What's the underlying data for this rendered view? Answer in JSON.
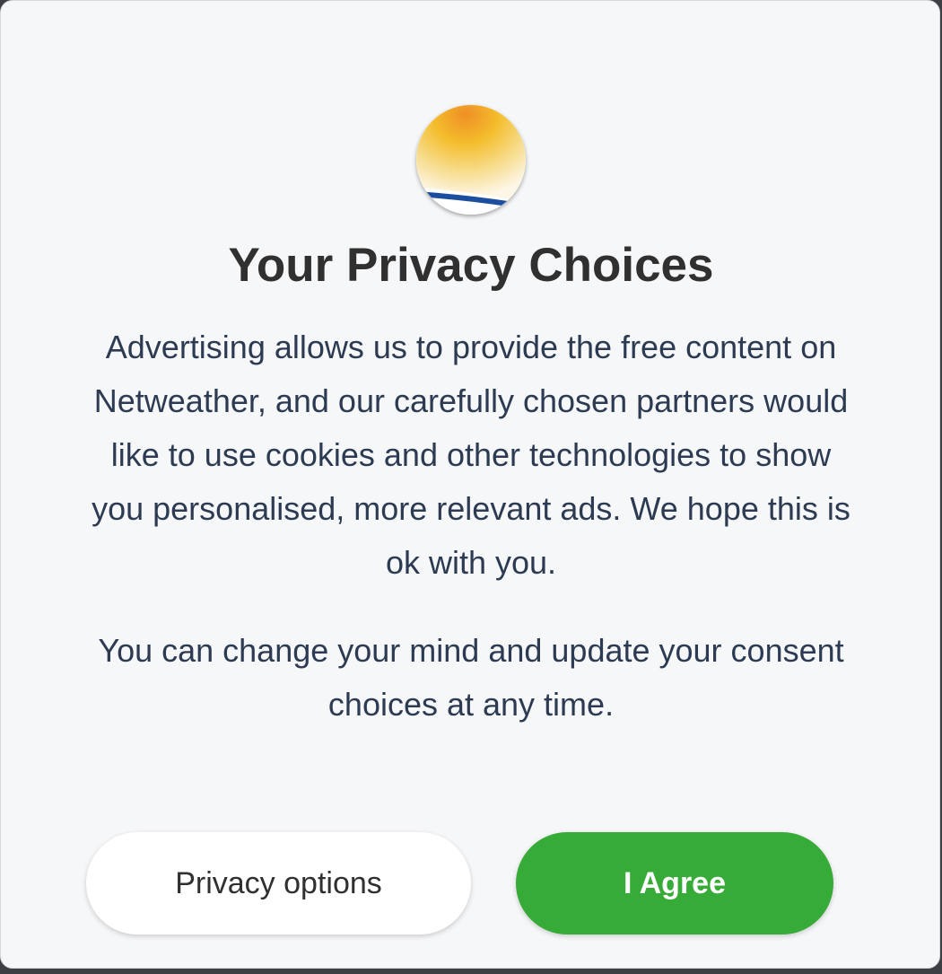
{
  "dialog": {
    "logo": {
      "icon": "netweather-sun-logo-icon"
    },
    "title": "Your Privacy Choices",
    "paragraphs": [
      "Advertising allows us to provide the free content on Netweather, and our carefully chosen partners would like to use cookies and other technologies to show you personalised, more relevant ads. We hope this is ok with you.",
      "You can change your mind and update your consent choices at any time."
    ],
    "buttons": {
      "privacy_options_label": "Privacy options",
      "agree_label": "I Agree"
    }
  },
  "colors": {
    "background": "#f6f7f9",
    "title": "#303030",
    "body_text": "#2d3b52",
    "agree_button": "#37ab37",
    "agree_text": "#ffffff",
    "logo_sun": "#f2b32a",
    "logo_stripe": "#1c4ea0"
  }
}
